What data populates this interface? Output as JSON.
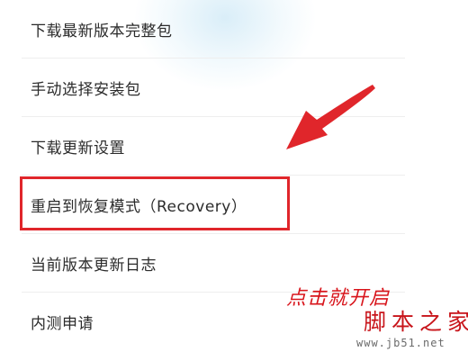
{
  "menu": {
    "items": [
      {
        "label": "下载最新版本完整包"
      },
      {
        "label": "手动选择安装包"
      },
      {
        "label": "下载更新设置"
      },
      {
        "label": "重启到恢复模式（Recovery）"
      },
      {
        "label": "当前版本更新日志"
      },
      {
        "label": "内测申请"
      }
    ]
  },
  "annotation": {
    "callout_text": "点击就开启",
    "highlight_color": "#e0262b",
    "arrow_color": "#e0262b",
    "arrow_icon": "arrow-pointer-icon"
  },
  "watermark": {
    "site_name": "脚本之家",
    "url": "www.jb51.net"
  }
}
